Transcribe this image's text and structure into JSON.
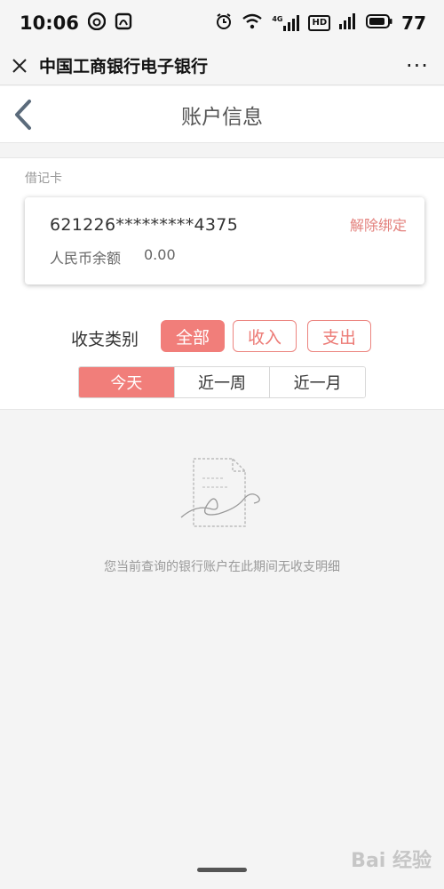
{
  "status_bar": {
    "time": "10:06",
    "signal_4g": "4G",
    "hd": "HD",
    "battery": "77"
  },
  "title_bar": {
    "title": "中国工商银行电子银行",
    "more": "···"
  },
  "header": {
    "title": "账户信息"
  },
  "card_section": {
    "label": "借记卡",
    "card_number": "621226*********4375",
    "unbind_label": "解除绑定",
    "balance_label": "人民币余额",
    "balance_value": "0.00"
  },
  "filter": {
    "label": "收支类别",
    "options": [
      "全部",
      "收入",
      "支出"
    ],
    "selected": "全部"
  },
  "period": {
    "options": [
      "今天",
      "近一周",
      "近一月"
    ],
    "selected": "今天"
  },
  "empty_state": {
    "message": "您当前查询的银行账户在此期间无收支明细"
  },
  "watermark": "Bai 经验",
  "colors": {
    "accent": "#f17e7a",
    "unbind": "#e3807c",
    "muted_text": "#999999"
  }
}
